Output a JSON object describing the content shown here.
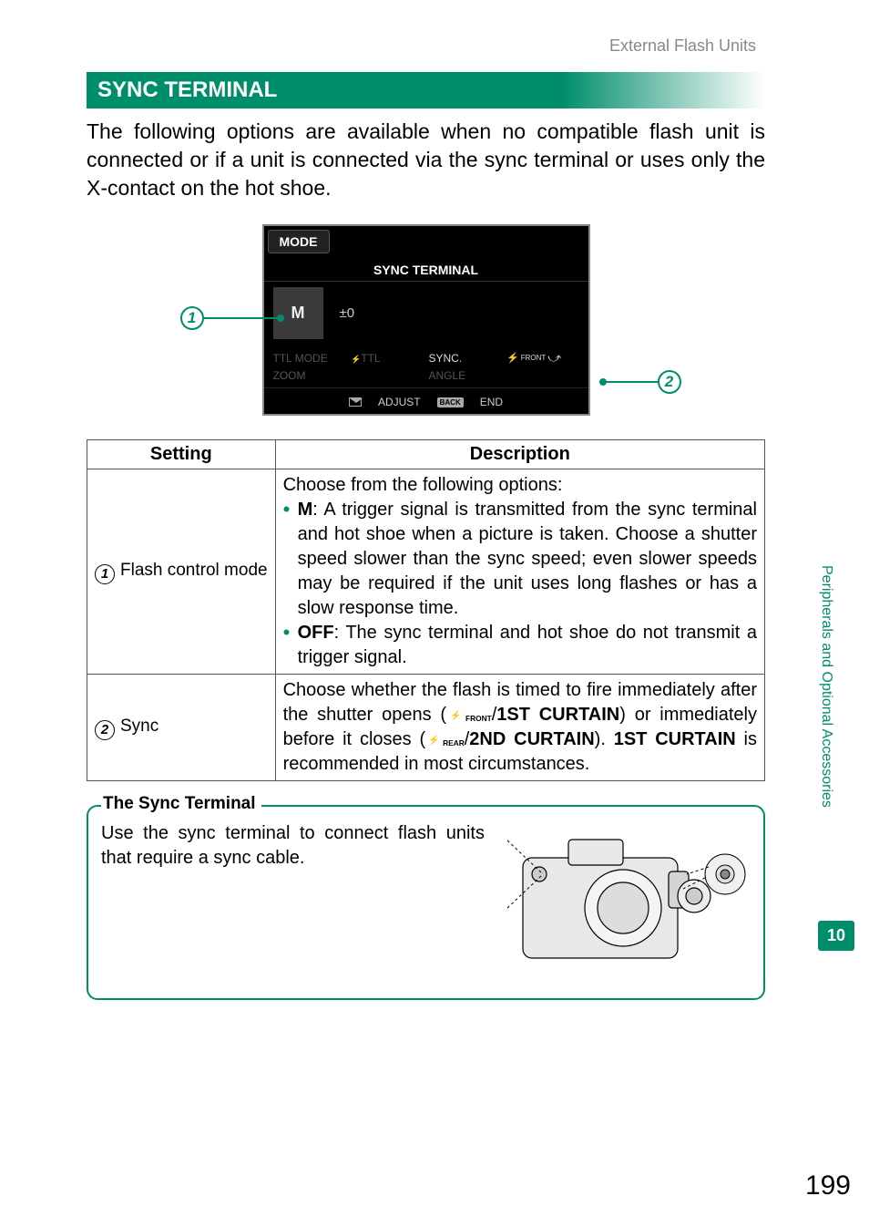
{
  "header": {
    "breadcrumb": "External Flash Units"
  },
  "section": {
    "title": "SYNC TERMINAL"
  },
  "intro": "The following options are available when no compatible flash unit is connected or if a unit is connected via the sync terminal or uses only the X-contact on the hot shoe.",
  "lcd": {
    "mode_label": "MODE",
    "title": "SYNC TERMINAL",
    "mode_value": "M",
    "comp_value": "±0",
    "rows": {
      "ttl_mode_label": "TTL MODE",
      "ttl_value": "TTL",
      "sync_label": "SYNC.",
      "sync_value": "FRONT",
      "zoom_label": "ZOOM",
      "angle_label": "ANGLE"
    },
    "bottom": {
      "adjust": "ADJUST",
      "back": "BACK",
      "end": "END"
    }
  },
  "callouts": {
    "one": "1",
    "two": "2"
  },
  "table": {
    "head_setting": "Setting",
    "head_desc": "Description",
    "rows": [
      {
        "num": "1",
        "label": "Flash control mode",
        "lead": "Choose from the following options:",
        "m_label": "M",
        "m_text": ": A trigger signal is transmitted from the sync terminal and hot shoe when a picture is taken. Choose a shutter speed slower than the sync speed; even slower speeds may be required if the unit uses long flashes or has a slow response time.",
        "off_label": "OFF",
        "off_text": ": The sync terminal and hot shoe do not transmit a trigger signal."
      },
      {
        "num": "2",
        "label": "Sync",
        "text_a": "Choose whether the flash is timed to fire immediately after the shutter opens (",
        "front_icon": "FRONT",
        "first_curtain": "1ST CURTAIN",
        "text_b": ") or immediately before it closes (",
        "rear_icon": "REAR",
        "second_curtain": "2ND CURTAIN",
        "text_c": "). ",
        "first_curtain2": "1ST CURTAIN",
        "text_d": " is recommended in most circumstances."
      }
    ]
  },
  "note": {
    "title": "The Sync Terminal",
    "text": "Use the sync terminal to connect flash units that require a sync cable."
  },
  "side": {
    "section_name": "Peripherals and Optional Accessories",
    "chapter": "10"
  },
  "page_number": "199"
}
